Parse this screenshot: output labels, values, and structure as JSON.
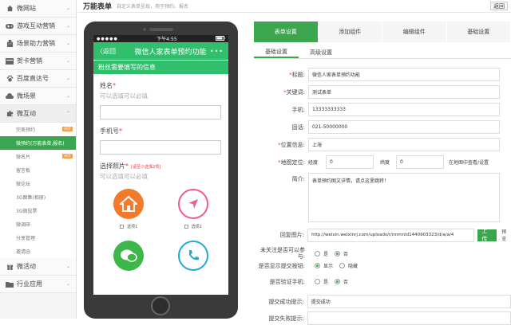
{
  "sidebar": {
    "items_top": [
      {
        "label": "微网站",
        "icon": "home-icon"
      },
      {
        "label": "游戏互动营销",
        "icon": "gamepad-icon"
      },
      {
        "label": "场景助力营销",
        "icon": "building-icon"
      },
      {
        "label": "贺卡营销",
        "icon": "card-icon"
      },
      {
        "label": "百度直达号",
        "icon": "paw-icon"
      },
      {
        "label": "微场景",
        "icon": "cloud-icon"
      }
    ],
    "open_item": {
      "label": "微互动",
      "icon": "puzzle-icon"
    },
    "sub_items": [
      {
        "label": "完美预约",
        "badge": "HOT"
      },
      {
        "label": "微预约(万能表单,报名)",
        "active": true
      },
      {
        "label": "微名片",
        "badge": "HOT"
      },
      {
        "label": "留言板"
      },
      {
        "label": "微论坛"
      },
      {
        "label": "3G图集(相册)"
      },
      {
        "label": "3G微投票"
      },
      {
        "label": "微调研"
      },
      {
        "label": "分享管理"
      },
      {
        "label": "邀请函"
      }
    ],
    "items_bottom": [
      {
        "label": "微活动",
        "icon": "gift-icon"
      },
      {
        "label": "行业应用",
        "icon": "folder-icon"
      }
    ]
  },
  "header": {
    "title": "万能表单",
    "subtitle": "自定义表单呈现，用于预约、报名",
    "back_label": "返回"
  },
  "phone": {
    "time": "下午4:55",
    "back": "〈返回",
    "title": "微信人家表单预约功能",
    "more": "•••",
    "section": "粉丝需要填写的信息",
    "fields": [
      {
        "label": "姓名",
        "required": true,
        "hint": "可以选填可以必填"
      },
      {
        "label": "手机号",
        "required": true,
        "hint": ""
      }
    ],
    "photo_label": "选择照片",
    "photo_req": "*",
    "photo_limit": "[请至少选择2项]",
    "photo_hint": "可以选填可以必填",
    "options": [
      {
        "label": "选项1",
        "icon": "house-icon",
        "color": "#f27a2a"
      },
      {
        "label": "选项2",
        "icon": "navigation-arrow-icon",
        "color": "#f05a8a"
      }
    ],
    "options_row2": [
      {
        "icon": "wechat-icon",
        "color": "#3cb84a"
      },
      {
        "icon": "phone-icon",
        "color": "#23a8d8"
      }
    ]
  },
  "tabs": [
    "表单设置",
    "添加组件",
    "编辑组件",
    "基础设置"
  ],
  "subtabs": [
    "基础设置",
    "高级设置"
  ],
  "form": {
    "keyword_label": "标题:",
    "keyword_value": "微信人家表单预约功能",
    "kw2_label": "关键词:",
    "kw2_value": "测试表单",
    "phone_label": "手机:",
    "phone_value": "13333333333",
    "tel_label": "固话:",
    "tel_value": "021-50000000",
    "loc_label": "位置信息:",
    "loc_value": "上海",
    "geo_label": "地图定位:",
    "lng_label": "经度",
    "lng_value": "0",
    "lat_label": "纬度",
    "lat_value": "0",
    "map_link": "在地图中查看/设置",
    "intro_label": "简介:",
    "intro_value": "表单预约图文详情，请点这里跳转！",
    "img_label": "回复图片:",
    "img_value": "http://weixin.weixinrj.com/uploads/r/rmmnld1440903323/d/a/a/4",
    "upload_label": "上传",
    "preview_label": "预览",
    "follow_label": "未关注是否可以参与:",
    "yes": "是",
    "no": "否",
    "show_btn_label": "是否显示提交按钮:",
    "show": "显示",
    "hide": "隐藏",
    "verify_label": "是否验证手机:",
    "success_label": "提交成功提示:",
    "success_value": "提交成功",
    "fail_label": "提交失败提示:"
  }
}
